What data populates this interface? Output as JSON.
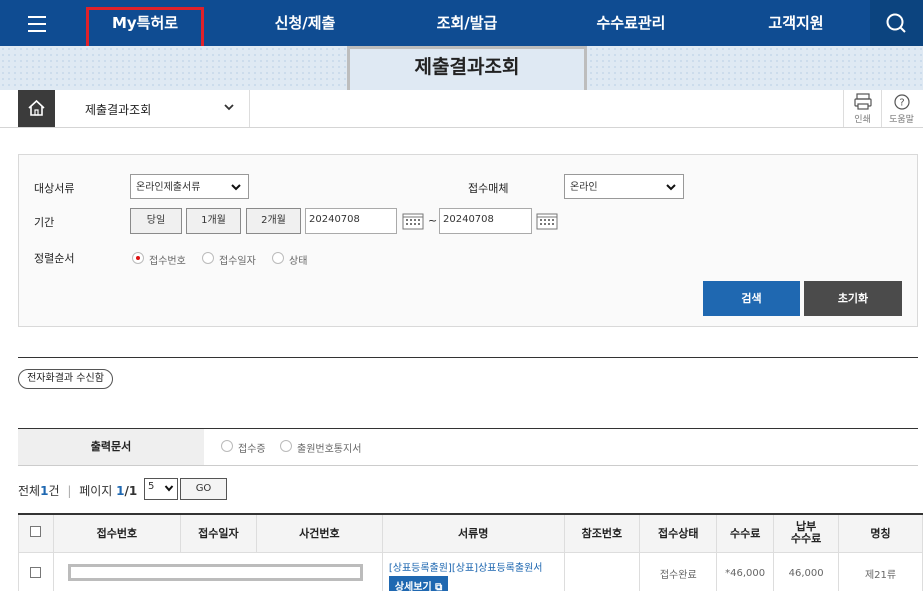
{
  "nav": {
    "items": [
      "My특허로",
      "신청/제출",
      "조회/발급",
      "수수료관리",
      "고객지원"
    ]
  },
  "page": {
    "title": "제출결과조회"
  },
  "breadcrumb": {
    "current": "제출결과조회"
  },
  "tools": {
    "print_label": "인쇄",
    "help_label": "도움말"
  },
  "search": {
    "doc_type_label": "대상서류",
    "doc_type_value": "온라인제출서류",
    "media_label": "접수매체",
    "media_value": "온라인",
    "period_label": "기간",
    "period_buttons": [
      "당일",
      "1개월",
      "2개월"
    ],
    "date_from": "20240708",
    "date_to": "20240708",
    "tilde": "~",
    "sort_label": "정렬순서",
    "sort_options": [
      "접수번호",
      "접수일자",
      "상태"
    ],
    "sort_selected": "접수번호",
    "search_button": "검색",
    "reset_button": "초기화"
  },
  "electronic_box_label": "전자화결과 수신함",
  "output": {
    "label": "출력문서",
    "options": [
      "접수증",
      "출원번호통지서"
    ]
  },
  "pager": {
    "total_prefix": "전체",
    "total_count": "1",
    "total_suffix": "건",
    "separator": "|",
    "page_prefix": "페이지",
    "page_current": "1",
    "page_total": "/1",
    "page_size": "5",
    "go_label": "GO"
  },
  "table": {
    "headers": [
      "접수번호",
      "접수일자",
      "사건번호",
      "서류명",
      "참조번호",
      "접수상태",
      "수수료",
      "납부\n수수료",
      "명칭"
    ],
    "rows": [
      {
        "doc_name": "[상표등록출원][상표]상표등록출원서",
        "detail_label": "상세보기",
        "status": "접수완료",
        "fee": "*46,000",
        "paid_fee": "46,000",
        "title": "제21류"
      }
    ]
  }
}
